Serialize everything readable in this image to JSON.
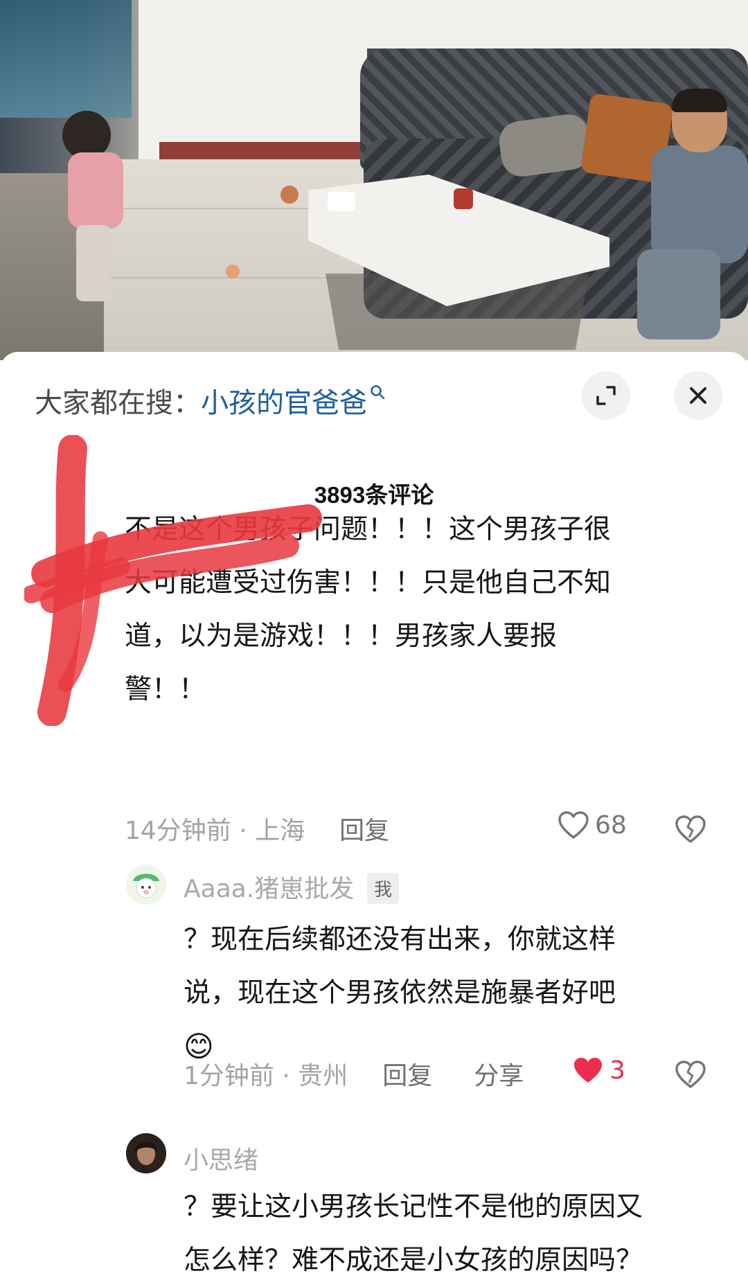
{
  "search": {
    "prefix": "大家都在搜：",
    "query": "小孩的官爸爸"
  },
  "comments_header": {
    "count_label": "3893条评论"
  },
  "comments": [
    {
      "text_lines": [
        "不是这个男孩子问题！！！这个男孩子很",
        "大可能遭受过伤害！！！只是他自己不知",
        "道，以为是游戏！！！男孩家人要报",
        "警！！"
      ],
      "time_location": "14分钟前 · 上海",
      "reply_label": "回复",
      "likes": "68",
      "liked": false
    },
    {
      "username": "Aaaa.猪崽批发",
      "badge": "我",
      "text_lines": [
        "？现在后续都还没有出来，你就这样",
        "说，现在这个男孩依然是施暴者好吧",
        "😊"
      ],
      "time_location": "1分钟前 · 贵州",
      "reply_label": "回复",
      "share_label": "分享",
      "likes": "3",
      "liked": true
    },
    {
      "username": "小思绪",
      "text_lines": [
        "？要让这小男孩长记性不是他的原因又",
        "怎么样？难不成还是小女孩的原因吗？"
      ]
    }
  ],
  "colors": {
    "link": "#1f5f9e",
    "liked_heart": "#ee2c4f",
    "muted_text": "#a3a3a3"
  }
}
